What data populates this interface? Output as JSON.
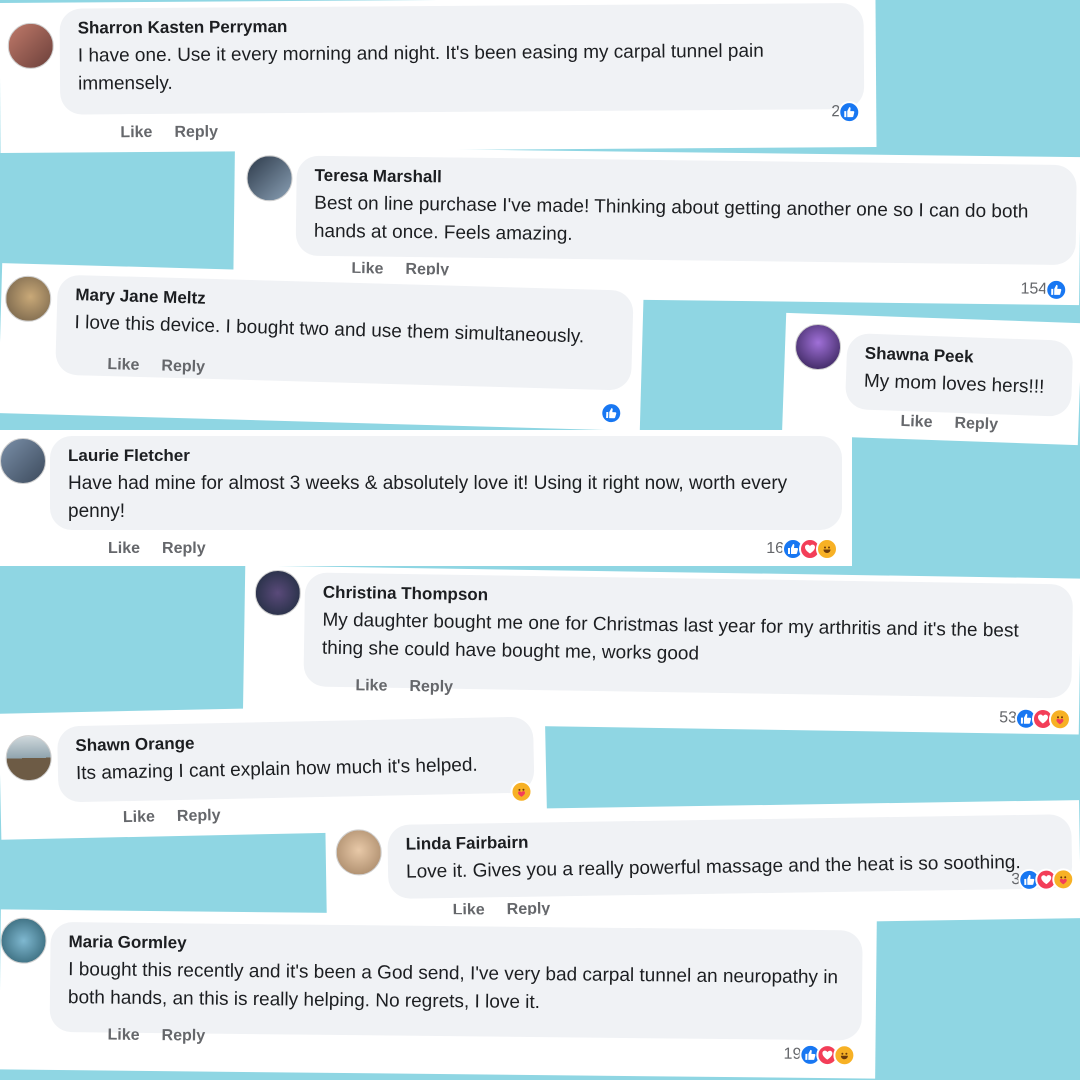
{
  "actions": {
    "like": "Like",
    "reply": "Reply"
  },
  "colors": {
    "background": "#8fd6e3",
    "like": "#1877f2",
    "love": "#f33e58",
    "care": "#f7b125"
  },
  "comments": [
    {
      "name": "Sharron Kasten Perryman",
      "text": "I have one. Use it every morning and night. It's been easing my carpal tunnel pain immensely.",
      "count": "2",
      "reactions": [
        "like"
      ]
    },
    {
      "name": "Teresa Marshall",
      "text": "Best on line purchase I've made! Thinking about getting another one so I can do both hands at once. Feels amazing.",
      "count": "154",
      "reactions": [
        "like"
      ]
    },
    {
      "name": "Mary Jane Meltz",
      "text": "I love this device. I bought two and use them simultaneously.",
      "count": "",
      "reactions": [
        "like"
      ]
    },
    {
      "name": "Shawna Peek",
      "text": "My mom loves hers!!!",
      "count": "",
      "reactions": []
    },
    {
      "name": "Laurie Fletcher",
      "text": "Have had mine for almost 3 weeks & absolutely love it! Using it right now, worth every penny!",
      "count": "16",
      "reactions": [
        "like",
        "love",
        "haha"
      ]
    },
    {
      "name": "Christina Thompson",
      "text": "My daughter bought me one for Christmas last year for my arthritis and it's the best thing she could have bought me, works good",
      "count": "53",
      "reactions": [
        "like",
        "love",
        "care"
      ]
    },
    {
      "name": "Shawn Orange",
      "text": "Its amazing I cant explain how much it's helped.",
      "count": "",
      "reactions": [
        "care"
      ]
    },
    {
      "name": "Linda Fairbairn",
      "text": "Love it. Gives you a really powerful massage and the heat is so soothing.",
      "count": "3",
      "reactions": [
        "like",
        "love",
        "care"
      ]
    },
    {
      "name": "Maria Gormley",
      "text": "I bought this recently and it's been a God send, I've very bad carpal tunnel an neuropathy in both hands, an this is really helping. No regrets, I love it.",
      "count": "19",
      "reactions": [
        "like",
        "love",
        "haha"
      ]
    }
  ]
}
